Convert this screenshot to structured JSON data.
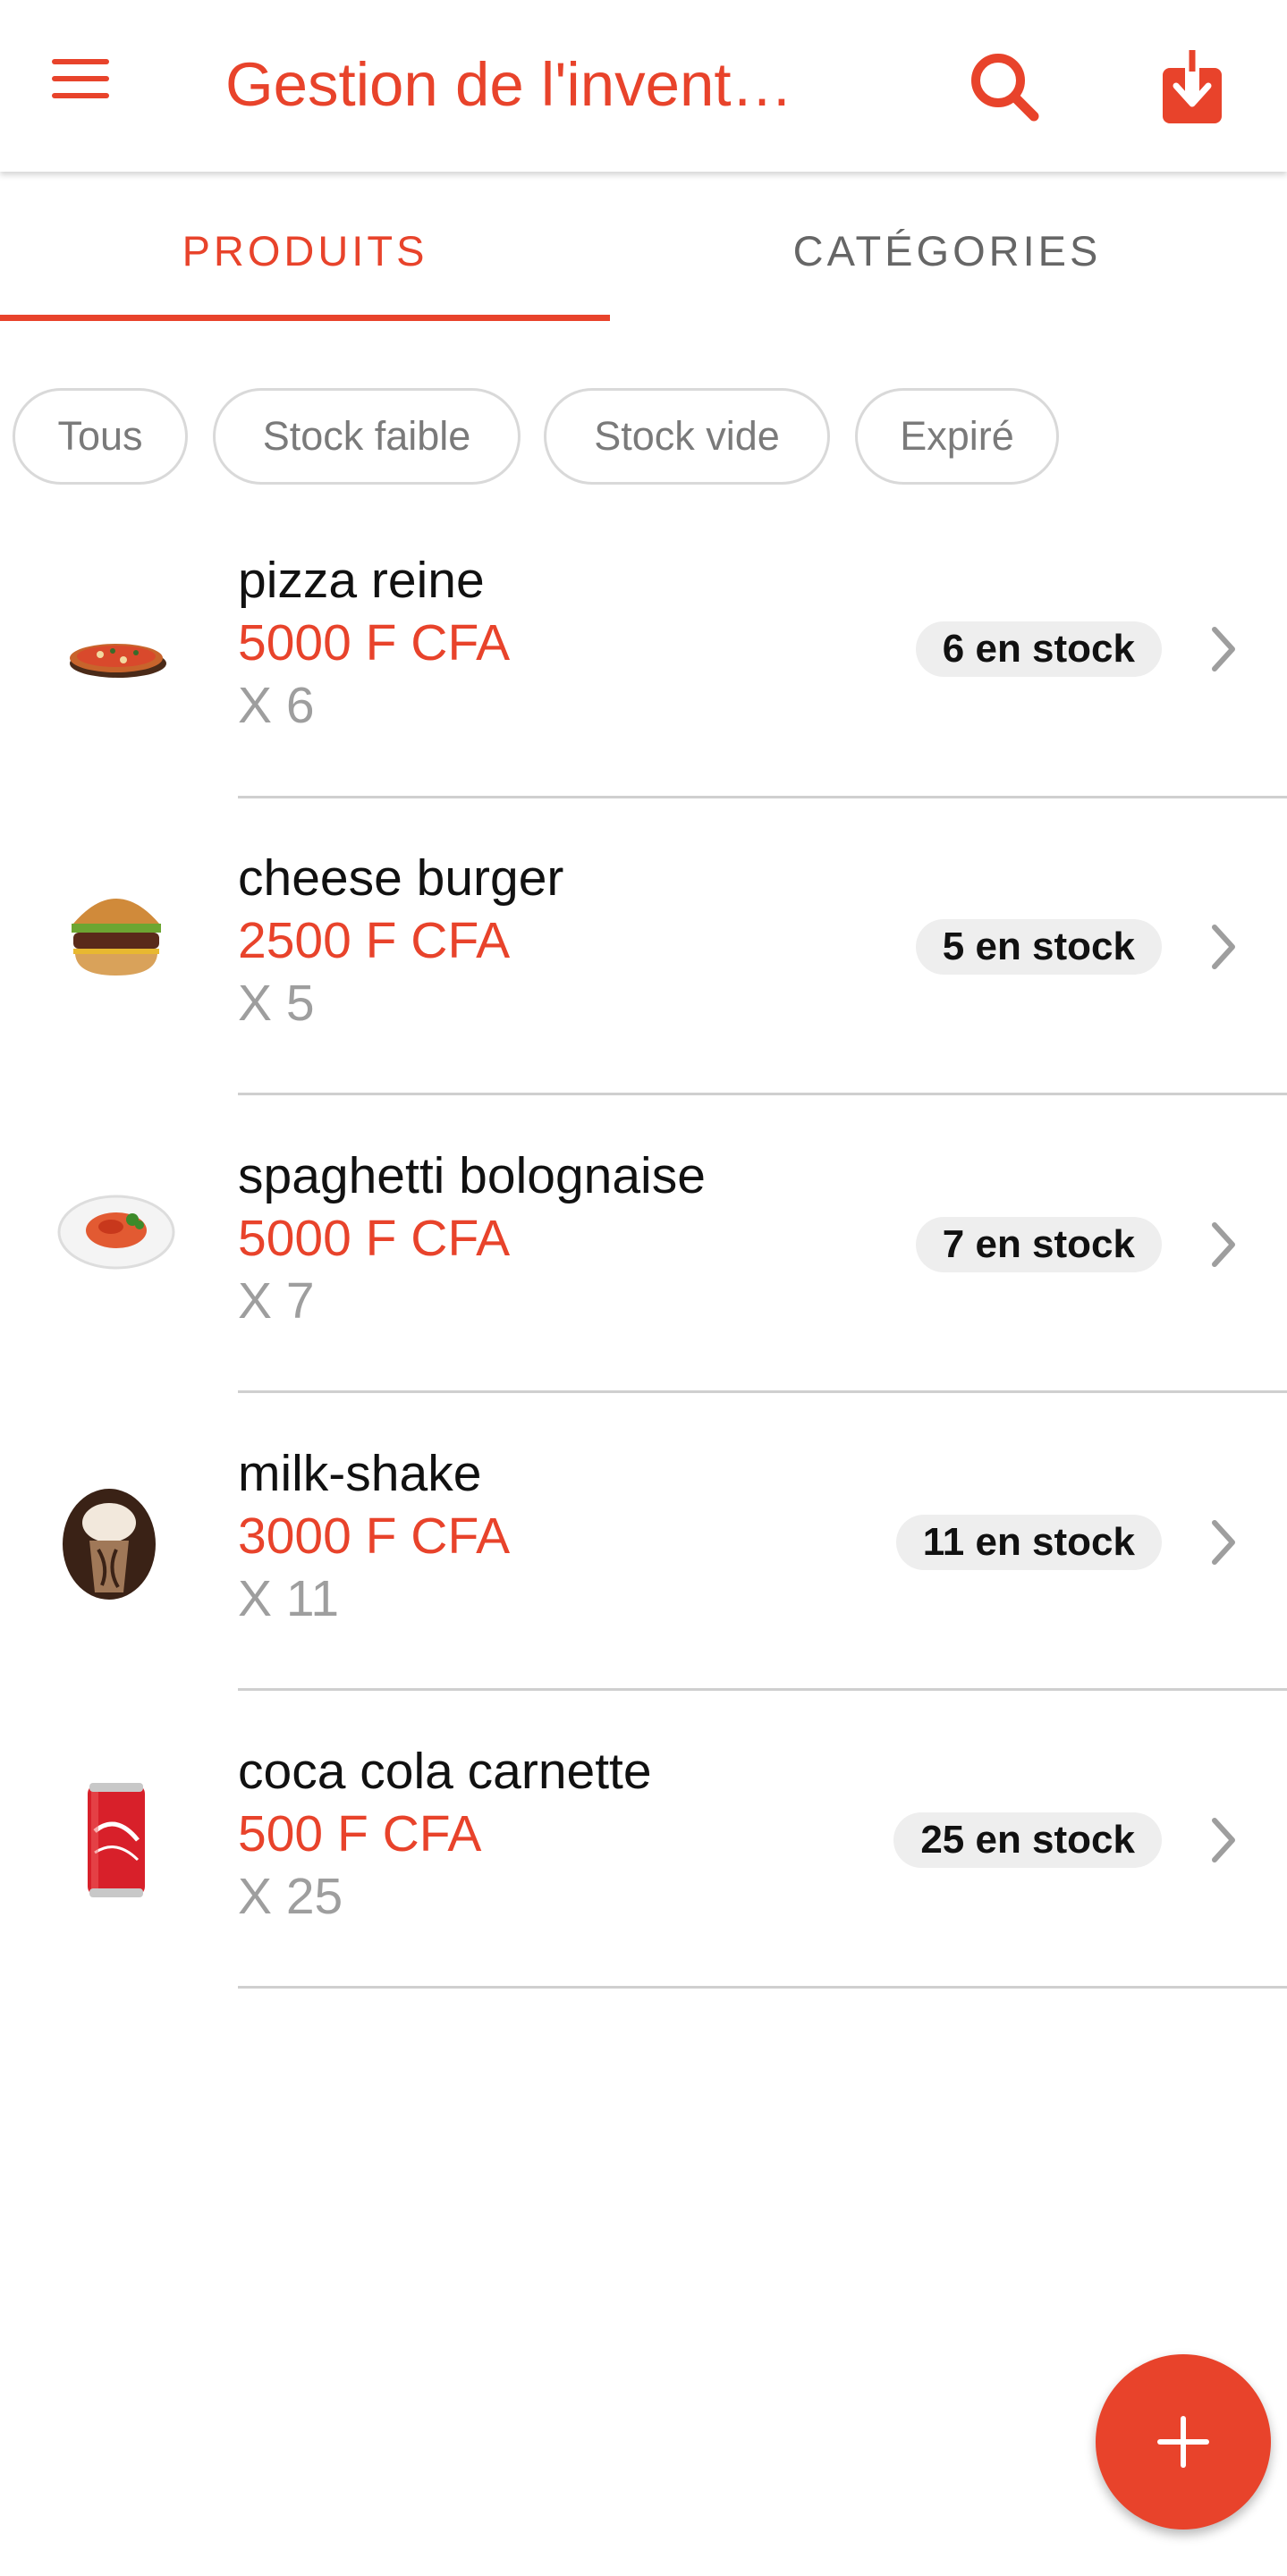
{
  "app": {
    "title": "Gestion de l'invent…",
    "accent_color": "#e8432b"
  },
  "header": {
    "menu_icon": "menu-icon",
    "search_icon": "search-icon",
    "download_icon": "download-icon"
  },
  "tabs": [
    {
      "label": "PRODUITS",
      "active": true
    },
    {
      "label": "CATÉGORIES",
      "active": false
    }
  ],
  "filters": [
    {
      "label": "Tous"
    },
    {
      "label": "Stock faible"
    },
    {
      "label": "Stock vide"
    },
    {
      "label": "Expiré"
    }
  ],
  "products": [
    {
      "name": "pizza reine",
      "price": "5000 F CFA",
      "qty": "X 6",
      "stock": "6 en stock",
      "icon": "pizza-thumbnail"
    },
    {
      "name": "cheese burger",
      "price": "2500 F CFA",
      "qty": "X 5",
      "stock": "5 en stock",
      "icon": "burger-thumbnail"
    },
    {
      "name": "spaghetti bolognaise",
      "price": "5000 F CFA",
      "qty": "X 7",
      "stock": "7 en stock",
      "icon": "spaghetti-thumbnail"
    },
    {
      "name": "milk-shake",
      "price": "3000 F CFA",
      "qty": "X 11",
      "stock": "11 en stock",
      "icon": "milkshake-thumbnail"
    },
    {
      "name": "coca cola carnette",
      "price": "500 F CFA",
      "qty": "X 25",
      "stock": "25 en stock",
      "icon": "soda-can-thumbnail"
    }
  ],
  "fab": {
    "icon": "plus-icon"
  }
}
